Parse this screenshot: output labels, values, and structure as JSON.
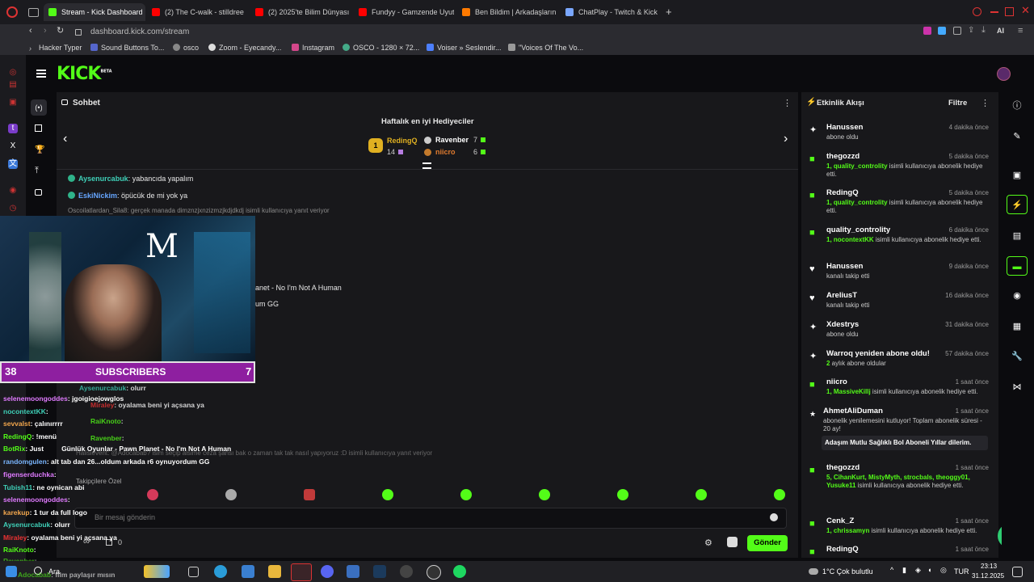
{
  "browser": {
    "tabs": [
      {
        "label": "Stream - Kick Dashboard",
        "color": "#53fc18"
      },
      {
        "label": "(2) The C-walk - stilldree",
        "color": "#ff0000"
      },
      {
        "label": "(2) 2025'te Bilim Dünyası",
        "color": "#ff0000"
      },
      {
        "label": "Fundyy - Gamzende Uyut",
        "color": "#ff0000"
      },
      {
        "label": "Ben Bildim | Arkadaşların",
        "color": "#ff7a00"
      },
      {
        "label": "ChatPlay - Twitch & Kick",
        "color": "#7aa7ff"
      }
    ],
    "new_tab_icon": "plus-icon",
    "url": "dashboard.kick.com/stream",
    "ai_label": "AI",
    "bookmarks": [
      "Hacker Typer",
      "Sound Buttons To...",
      "osco",
      "Zoom - Eyecandy...",
      "Instagram",
      "OSCO - 1280 × 72...",
      "Voiser » Seslendir...",
      "\"Voices Of The Vo..."
    ]
  },
  "kick": {
    "logo": "KICK",
    "logo_sup": "BETA"
  },
  "chat": {
    "title": "Sohbet",
    "leaderboard_title": "Haftalık en iyi Hediyeciler",
    "top1": {
      "rank": "1",
      "name": "RedingQ",
      "count": "14"
    },
    "top2": {
      "name": "Ravenber",
      "count": "7"
    },
    "top3": {
      "name": "niicro",
      "count": "6"
    },
    "messages": [
      {
        "user": "Aysenurcabuk",
        "text": ": yabancıda yapalım"
      },
      {
        "user": "EskiNickim",
        "text": ": öpücük de mi yok ya"
      }
    ],
    "reply_note": "Oscoilatlardan_Sila8: gerçek manada dimznzjxnzizmzjkdjdkdj isimli kullanıcıya yanıt veriyor",
    "partial1": "anet - No I'm Not A Human",
    "partial2": "um GG",
    "ghost_lines": [
      {
        "user": "Aysenurcabuk",
        "text": ": olurr"
      },
      {
        "user": "Miraley",
        "text": ": oyalama beni yi açsana ya"
      },
      {
        "user": "RaiKnoto",
        "text": ":"
      },
      {
        "user": "Ravenber",
        "text": ":"
      }
    ],
    "reply_note2": "Halisievent: @Adocabab? isim seçip alsime ceza şansı bak o zaman tak tak nasıl yapıyoruz :D isimli kullanıcıya yanıt veriyor",
    "follower_only": "Takipçilere Özel",
    "input_placeholder": "Bir mesaj gönderin",
    "send_label": "Gönder",
    "viewer_count": "0"
  },
  "overlay": {
    "subs_left": "38",
    "subs_label": "SUBSCRIBERS",
    "subs_right": "7",
    "lines": [
      {
        "user": "selenemoongoddes",
        "text": ": jgoigioejowglos"
      },
      {
        "user": "nocontextKK",
        "text": ":"
      },
      {
        "user": "sevvalst",
        "text": ": çalınırrrr"
      },
      {
        "user": "RedingQ",
        "text": ": !menü"
      },
      {
        "user": "BotRix",
        "text": ": Just",
        "extra": "Günlük Oyunlar - Pawn Planet - No I'm Not A Human"
      },
      {
        "user": "randomgulen",
        "text": ": alt tab dan 26...oldum arkada r6 oynuyordum GG"
      },
      {
        "user": "figenserduchka",
        "text": ":"
      },
      {
        "user": "Tubish11",
        "text": ": ne oynican abi"
      },
      {
        "user": "selenemoongoddes",
        "text": ":"
      },
      {
        "user": "karekup",
        "text": ": 1 tur da full logo"
      },
      {
        "user": "Aysenurcabuk",
        "text": ": olurr"
      },
      {
        "user": "Miraley",
        "text": ": oyalama beni yi açsana ya"
      },
      {
        "user": "RaiKnoto",
        "text": ":"
      },
      {
        "user": "Ravenber",
        "text": ":"
      },
      {
        "user": "Adocabab",
        "text": ": film paylaşır mısın"
      }
    ]
  },
  "activity": {
    "title": "Etkinlik Akışı",
    "filter_label": "Filtre",
    "items": [
      {
        "icon": "sparkle-icon",
        "name": "Hanussen",
        "time": "4 dakika önce",
        "desc": "abone oldu"
      },
      {
        "icon": "gift-icon",
        "name": "thegozzd",
        "time": "5 dakika önce",
        "hl": "1, quality_controlity",
        "desc": " isimli kullanıcıya abonelik hediye etti."
      },
      {
        "icon": "gift-icon",
        "name": "RedingQ",
        "time": "5 dakika önce",
        "hl": "1, quality_controlity",
        "desc": " isimli kullanıcıya abonelik hediye etti."
      },
      {
        "icon": "gift-icon",
        "name": "quality_controlity",
        "time": "6 dakika önce",
        "hl": "1, nocontextKK",
        "desc": " isimli kullanıcıya abonelik hediye etti."
      },
      {
        "icon": "heart-icon",
        "name": "Hanussen",
        "time": "9 dakika önce",
        "desc": "kanalı takip etti"
      },
      {
        "icon": "heart-icon",
        "name": "AreliusT",
        "time": "16 dakika önce",
        "desc": "kanalı takip etti"
      },
      {
        "icon": "sparkle-icon",
        "name": "Xdestrys",
        "time": "31 dakika önce",
        "desc": "abone oldu"
      },
      {
        "icon": "sparkle-icon",
        "name": "Warroq yeniden abone oldu!",
        "time": "57 dakika önce",
        "hl": "2",
        "desc": " aylık abone oldular"
      },
      {
        "icon": "gift-icon",
        "name": "niicro",
        "time": "1 saat önce",
        "hl": "1, MassiveKillj",
        "desc": " isimli kullanıcıya abonelik hediye etti."
      },
      {
        "icon": "star-icon",
        "name": "AhmetAliDuman",
        "time": "1 saat önce",
        "desc": "abonelik yenilemesini kutluyor! Toplam abonelik süresi - 20 ay!",
        "note": "Adaşım Mutlu Sağlıklı Bol Aboneli Yıllar dilerim."
      },
      {
        "icon": "gift-icon",
        "name": "thegozzd",
        "time": "1 saat önce",
        "hl": "5, CihanKurt, MistyMyth, strocbals, theoggy01, Yusuke11",
        "desc": " isimli kullanıcıya abonelik hediye etti."
      },
      {
        "icon": "gift-icon",
        "name": "Cenk_Z",
        "time": "1 saat önce",
        "hl": "1, chrissamyn",
        "desc": " isimli kullanıcıya abonelik hediye etti."
      },
      {
        "icon": "gift-icon",
        "name": "RedingQ",
        "time": "1 saat önce",
        "desc": ""
      }
    ]
  },
  "taskbar": {
    "search_label": "Ara",
    "weather": "1°C  Çok bulutlu",
    "lang": "TUR",
    "time": "23:13",
    "date": "31.12.2025"
  },
  "colors": {
    "brand": "#53fc18",
    "accent": "#8e1fa0",
    "youtube": "#ff0000"
  }
}
